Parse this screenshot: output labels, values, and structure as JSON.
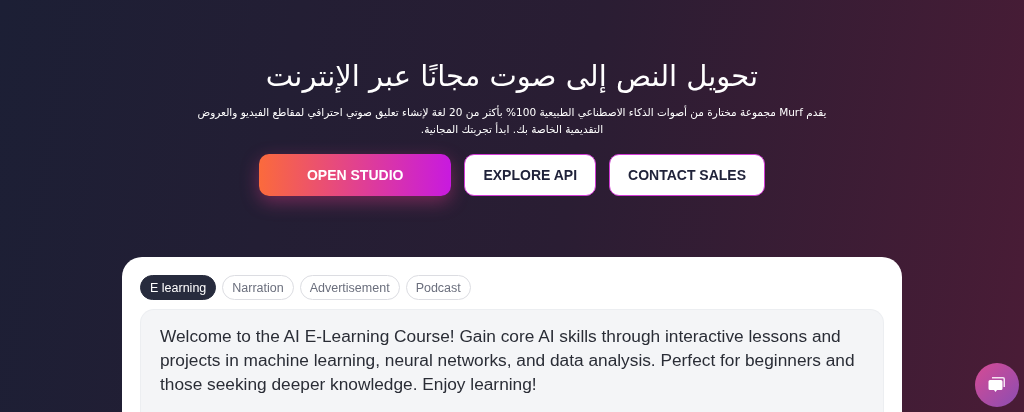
{
  "hero": {
    "title": "تحويل النص إلى صوت مجانًا  عبر الإنترنت",
    "subtitle": "يقدم Murf مجموعة مختارة من أصوات الذكاء الاصطناعي الطبيعية 100% بأكثر من 20 لغة لإنشاء تعليق صوتي احترافي لمقاطع الفيديو والعروض التقديمية الخاصة بك. ابدأ تجربتك المجانية.",
    "buttons": [
      {
        "label": "OPEN STUDIO",
        "kind": "primary"
      },
      {
        "label": "EXPLORE API",
        "kind": "outline"
      },
      {
        "label": "CONTACT SALES",
        "kind": "outline"
      }
    ]
  },
  "demo": {
    "tabs": [
      {
        "label": "E learning",
        "selected": true
      },
      {
        "label": "Narration",
        "selected": false
      },
      {
        "label": "Advertisement",
        "selected": false
      },
      {
        "label": "Podcast",
        "selected": false
      }
    ],
    "text": "Welcome to the AI E-Learning Course! Gain core AI skills through interactive lessons and projects in machine learning, neural networks, and data analysis. Perfect for beginners and those seeking deeper knowledge. Enjoy learning!"
  }
}
